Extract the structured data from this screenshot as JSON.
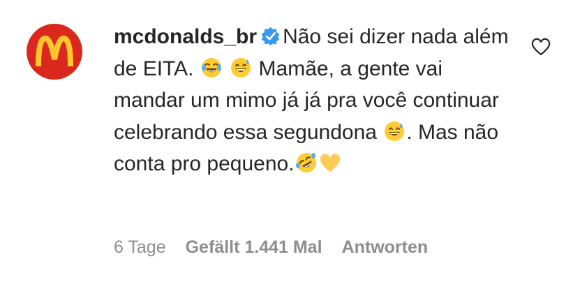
{
  "comment": {
    "username": "mcdonalds_br",
    "verified": true,
    "text_parts": {
      "p1": "Não sei dizer nada além de EITA.",
      "p2": "Mamãe, a gente vai mandar um mimo já já pra você continuar celebrando essa segundona",
      "p3": ". Mas não conta pro pequeno."
    },
    "emojis": [
      "face-with-tears-of-joy",
      "grinning-face-with-sweat",
      "grinning-face-with-sweat",
      "rolling-on-the-floor-laughing",
      "yellow-heart"
    ],
    "time": "6 Tage",
    "likes": "Gefällt 1.441 Mal",
    "reply_label": "Antworten"
  },
  "colors": {
    "brand_red": "#DA291C",
    "brand_yellow": "#FFC72C",
    "verified_blue": "#3897F0",
    "text": "#262626",
    "muted": "#8e8e8e"
  }
}
